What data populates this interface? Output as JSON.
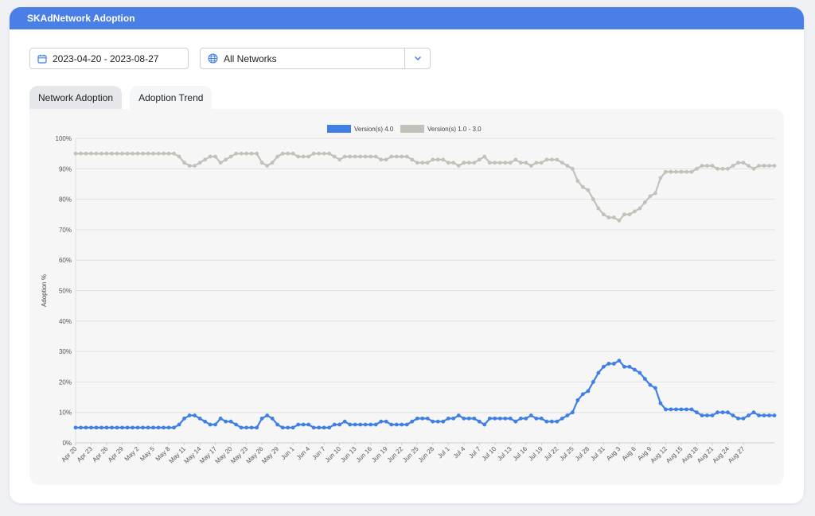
{
  "header": {
    "title": "SKAdNetwork Adoption"
  },
  "filters": {
    "date_range": "2023-04-20 - 2023-08-27",
    "network": "All Networks",
    "calendar_icon": "calendar-icon",
    "network_icon": "globe-icon",
    "dropdown_icon": "chevron-down-icon"
  },
  "tabs": [
    {
      "label": "Network Adoption",
      "active": true
    },
    {
      "label": "Adoption Trend",
      "active": false
    }
  ],
  "colors": {
    "accent": "#4a7fe5",
    "v4": "#3f7fe6",
    "v1to3": "#c2c2bb"
  },
  "chart_data": {
    "type": "line",
    "ylabel": "Adoption %",
    "xlabel": "",
    "ylim": [
      0,
      100
    ],
    "yticks": [
      "0%",
      "10%",
      "20%",
      "30%",
      "40%",
      "50%",
      "60%",
      "70%",
      "80%",
      "90%",
      "100%"
    ],
    "grid": true,
    "legend_position": "top",
    "start_date": "2023-04-20",
    "xtick_labels": [
      "Apr 20",
      "Apr 23",
      "Apr 26",
      "Apr 29",
      "May 2",
      "May 5",
      "May 8",
      "May 11",
      "May 14",
      "May 17",
      "May 20",
      "May 23",
      "May 26",
      "May 29",
      "Jun 1",
      "Jun 4",
      "Jun 7",
      "Jun 10",
      "Jun 13",
      "Jun 16",
      "Jun 19",
      "Jun 22",
      "Jun 25",
      "Jun 28",
      "Jul 1",
      "Jul 4",
      "Jul 7",
      "Jul 10",
      "Jul 13",
      "Jul 16",
      "Jul 19",
      "Jul 22",
      "Jul 25",
      "Jul 28",
      "Jul 31",
      "Aug 3",
      "Aug 6",
      "Aug 9",
      "Aug 12",
      "Aug 15",
      "Aug 18",
      "Aug 21",
      "Aug 24",
      "Aug 27"
    ],
    "series": [
      {
        "name": "Version(s) 4.0",
        "color": "#3f7fe6",
        "values": [
          5,
          5,
          5,
          5,
          5,
          5,
          5,
          5,
          5,
          5,
          5,
          5,
          5,
          5,
          5,
          5,
          5,
          5,
          5,
          5,
          6,
          8,
          9,
          9,
          8,
          7,
          6,
          6,
          8,
          7,
          7,
          6,
          5,
          5,
          5,
          5,
          8,
          9,
          8,
          6,
          5,
          5,
          5,
          6,
          6,
          6,
          5,
          5,
          5,
          5,
          6,
          6,
          7,
          6,
          6,
          6,
          6,
          6,
          6,
          7,
          7,
          6,
          6,
          6,
          6,
          7,
          8,
          8,
          8,
          7,
          7,
          7,
          8,
          8,
          9,
          8,
          8,
          8,
          7,
          6,
          8,
          8,
          8,
          8,
          8,
          7,
          8,
          8,
          9,
          8,
          8,
          7,
          7,
          7,
          8,
          9,
          10,
          14,
          16,
          17,
          20,
          23,
          25,
          26,
          26,
          27,
          25,
          25,
          24,
          23,
          21,
          19,
          18,
          13,
          11,
          11,
          11,
          11,
          11,
          11,
          10,
          9,
          9,
          9,
          10,
          10,
          10,
          9,
          8,
          8,
          9,
          10,
          9,
          9,
          9,
          9
        ]
      },
      {
        "name": "Version(s) 1.0 - 3.0",
        "color": "#c2c2bb",
        "values": [
          95,
          95,
          95,
          95,
          95,
          95,
          95,
          95,
          95,
          95,
          95,
          95,
          95,
          95,
          95,
          95,
          95,
          95,
          95,
          95,
          94,
          92,
          91,
          91,
          92,
          93,
          94,
          94,
          92,
          93,
          94,
          95,
          95,
          95,
          95,
          95,
          92,
          91,
          92,
          94,
          95,
          95,
          95,
          94,
          94,
          94,
          95,
          95,
          95,
          95,
          94,
          93,
          94,
          94,
          94,
          94,
          94,
          94,
          94,
          93,
          93,
          94,
          94,
          94,
          94,
          93,
          92,
          92,
          92,
          93,
          93,
          93,
          92,
          92,
          91,
          92,
          92,
          92,
          93,
          94,
          92,
          92,
          92,
          92,
          92,
          93,
          92,
          92,
          91,
          92,
          92,
          93,
          93,
          93,
          92,
          91,
          90,
          86,
          84,
          83,
          80,
          77,
          75,
          74,
          74,
          73,
          75,
          75,
          76,
          77,
          79,
          81,
          82,
          87,
          89,
          89,
          89,
          89,
          89,
          89,
          90,
          91,
          91,
          91,
          90,
          90,
          90,
          91,
          92,
          92,
          91,
          90,
          91,
          91,
          91,
          91
        ]
      }
    ]
  }
}
